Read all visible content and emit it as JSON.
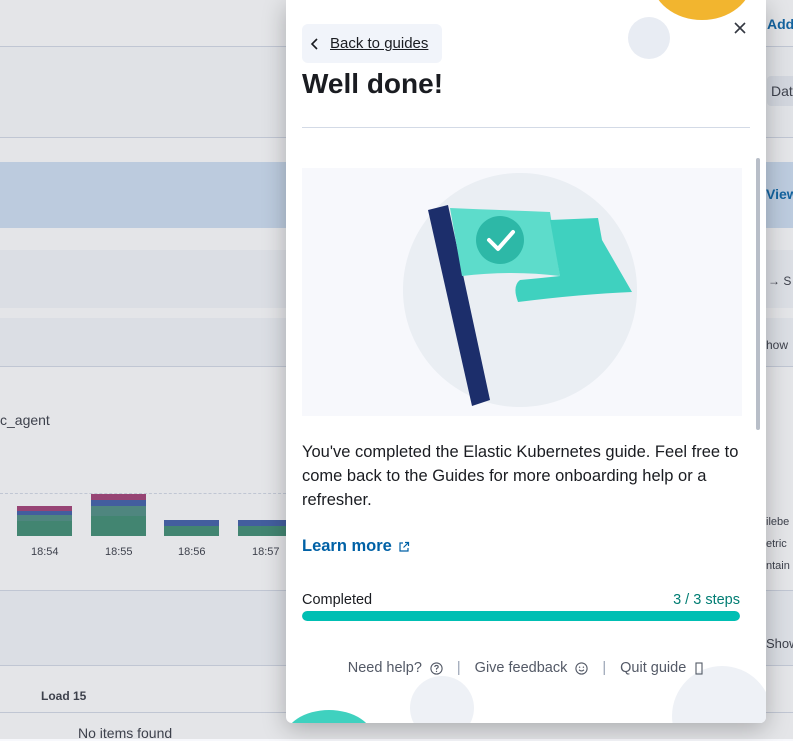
{
  "background": {
    "top_right_link": "Add",
    "date_button": "Dat",
    "view_button": "View",
    "arrow_text": "S",
    "show_link_1": "how",
    "agent_label": "c_agent",
    "time_ticks": [
      "18:54",
      "18:55",
      "18:56",
      "18:57"
    ],
    "legend_fragments": [
      "ilebe",
      "etric",
      "ntain"
    ],
    "show_link_2": "Show",
    "column_header": "Load 15",
    "empty_message": "No items found"
  },
  "panel": {
    "back_label": "Back to guides",
    "title": "Well done!",
    "description": "You've completed the Elastic Kubernetes guide. Feel free to come back to the Guides for more onboarding help or a refresher.",
    "learn_more": "Learn more",
    "progress": {
      "label": "Completed",
      "count_text": "3 / 3 steps",
      "completed": 3,
      "total": 3,
      "color": "#00bfb3"
    },
    "footer": {
      "help": "Need help?",
      "feedback": "Give feedback",
      "quit": "Quit guide"
    }
  },
  "colors": {
    "link": "#0061a6",
    "success": "#017d73",
    "flag_pole": "#1c2e6b",
    "flag": "#3fd1bf"
  }
}
